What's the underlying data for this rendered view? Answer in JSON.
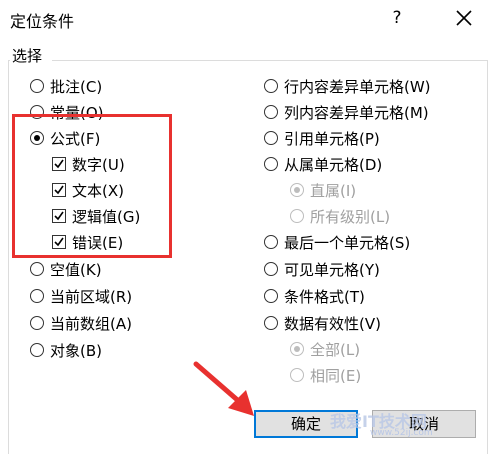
{
  "window": {
    "title": "定位条件",
    "help_label": "?"
  },
  "section_label": "选择",
  "left_options": [
    {
      "label": "批注(C)",
      "type": "radio",
      "selected": false,
      "disabled": false
    },
    {
      "label": "常量(O)",
      "type": "radio",
      "selected": false,
      "disabled": false
    },
    {
      "label": "公式(F)",
      "type": "radio",
      "selected": true,
      "disabled": false
    },
    {
      "label": "数字(U)",
      "type": "checkbox",
      "checked": true
    },
    {
      "label": "文本(X)",
      "type": "checkbox",
      "checked": true
    },
    {
      "label": "逻辑值(G)",
      "type": "checkbox",
      "checked": true
    },
    {
      "label": "错误(E)",
      "type": "checkbox",
      "checked": true
    },
    {
      "label": "空值(K)",
      "type": "radio",
      "selected": false,
      "disabled": false
    },
    {
      "label": "当前区域(R)",
      "type": "radio",
      "selected": false,
      "disabled": false
    },
    {
      "label": "当前数组(A)",
      "type": "radio",
      "selected": false,
      "disabled": false
    },
    {
      "label": "对象(B)",
      "type": "radio",
      "selected": false,
      "disabled": false
    }
  ],
  "right_options": [
    {
      "label": "行内容差异单元格(W)",
      "type": "radio",
      "selected": false,
      "disabled": false
    },
    {
      "label": "列内容差异单元格(M)",
      "type": "radio",
      "selected": false,
      "disabled": false
    },
    {
      "label": "引用单元格(P)",
      "type": "radio",
      "selected": false,
      "disabled": false
    },
    {
      "label": "从属单元格(D)",
      "type": "radio",
      "selected": false,
      "disabled": false
    },
    {
      "label": "直属(I)",
      "type": "radio",
      "selected": true,
      "disabled": true
    },
    {
      "label": "所有级别(L)",
      "type": "radio",
      "selected": false,
      "disabled": true
    },
    {
      "label": "最后一个单元格(S)",
      "type": "radio",
      "selected": false,
      "disabled": false
    },
    {
      "label": "可见单元格(Y)",
      "type": "radio",
      "selected": false,
      "disabled": false
    },
    {
      "label": "条件格式(T)",
      "type": "radio",
      "selected": false,
      "disabled": false
    },
    {
      "label": "数据有效性(V)",
      "type": "radio",
      "selected": false,
      "disabled": false
    },
    {
      "label": "全部(L)",
      "type": "radio",
      "selected": true,
      "disabled": true
    },
    {
      "label": "相同(E)",
      "type": "radio",
      "selected": false,
      "disabled": true
    }
  ],
  "buttons": {
    "ok": "确定",
    "cancel": "取消"
  },
  "watermark": {
    "text": "我爱IT技术网",
    "url": "www.52ij.com"
  },
  "colors": {
    "highlight": "#e8312f",
    "arrow": "#e8312f",
    "default_button_border": "#0078d7"
  }
}
